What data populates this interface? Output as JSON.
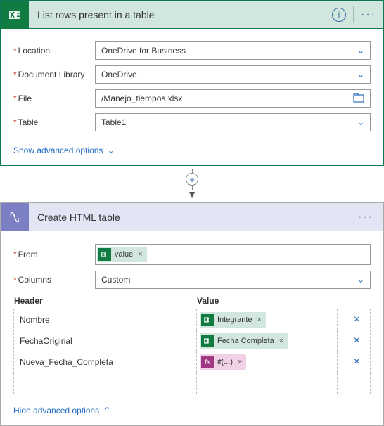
{
  "card1": {
    "title": "List rows present in a table",
    "fields": {
      "location": {
        "label": "Location",
        "value": "OneDrive for Business"
      },
      "docLib": {
        "label": "Document Library",
        "value": "OneDrive"
      },
      "file": {
        "label": "File",
        "value": "/Manejo_tiempos.xlsx"
      },
      "table": {
        "label": "Table",
        "value": "Table1"
      }
    },
    "advLink": "Show advanced options"
  },
  "card2": {
    "title": "Create HTML table",
    "fromLabel": "From",
    "fromToken": "value",
    "columnsLabel": "Columns",
    "columnsValue": "Custom",
    "headerCol": "Header",
    "valueCol": "Value",
    "rows": [
      {
        "header": "Nombre",
        "tokenType": "excel",
        "tokenLabel": "Integrante"
      },
      {
        "header": "FechaOriginal",
        "tokenType": "excel",
        "tokenLabel": "Fecha Completa"
      },
      {
        "header": "Nueva_Fecha_Completa",
        "tokenType": "fx",
        "tokenLabel": "if(...)"
      }
    ],
    "advLink": "Hide advanced options"
  }
}
